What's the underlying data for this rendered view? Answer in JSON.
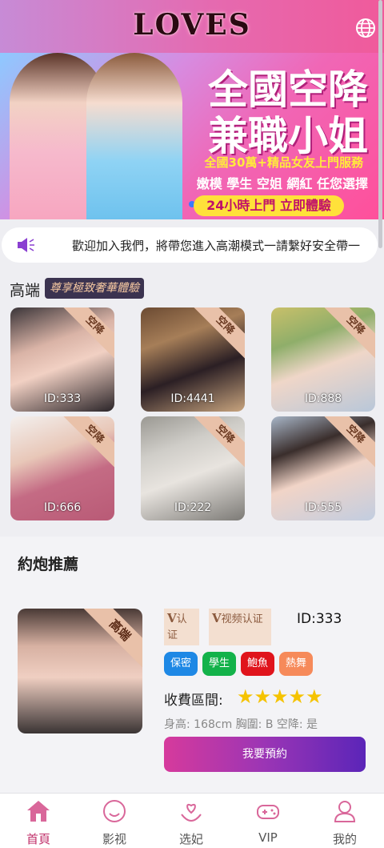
{
  "header": {
    "logo": "LOVES",
    "lang_icon": "globe-icon"
  },
  "banner": {
    "title_line1": "全國空降",
    "title_line2": "兼職小姐",
    "sub1": "全國30萬+精品女友上門服務",
    "sub2": "嫩模 學生 空姐 網紅 任您選擇",
    "pill": "24小時上門 立即體驗"
  },
  "notice": {
    "icon": "speaker-icon",
    "text": "歡迎加入我們，將帶您進入高潮模式一請繫好安全帶一"
  },
  "high_end": {
    "title": "高端",
    "badge": "尊享極致奢華體驗",
    "cards": [
      {
        "id": "ID:333",
        "tag": "空降"
      },
      {
        "id": "ID:4441",
        "tag": "空降"
      },
      {
        "id": "ID:888",
        "tag": "空降"
      },
      {
        "id": "ID:666",
        "tag": "空降"
      },
      {
        "id": "ID:222",
        "tag": "空降"
      },
      {
        "id": "ID:555",
        "tag": "空降"
      }
    ]
  },
  "recommend": {
    "title": "約炮推薦",
    "corner": "高端",
    "v1": {
      "v": "V",
      "label": "认证"
    },
    "v2": {
      "v": "V",
      "label": "视频认证"
    },
    "id": "ID:333",
    "tags": [
      "保密",
      "學生",
      "鮑魚",
      "熱舞"
    ],
    "tag_colors": [
      "#1e88e5",
      "#13b24a",
      "#e0141c",
      "#f68a5a"
    ],
    "fee_label": "收費區間:",
    "rating": 5,
    "stars": "★★★★★",
    "spec": "身高: 168cm 胸圍: B 空降: 是",
    "book_label": "我要預約"
  },
  "nav": [
    {
      "label": "首頁",
      "icon": "home-icon",
      "active": true
    },
    {
      "label": "影视",
      "icon": "smile-icon",
      "active": false
    },
    {
      "label": "选妃",
      "icon": "heart-hand-icon",
      "active": false
    },
    {
      "label": "VIP",
      "icon": "gamepad-icon",
      "active": false
    },
    {
      "label": "我的",
      "icon": "user-icon",
      "active": false
    }
  ]
}
